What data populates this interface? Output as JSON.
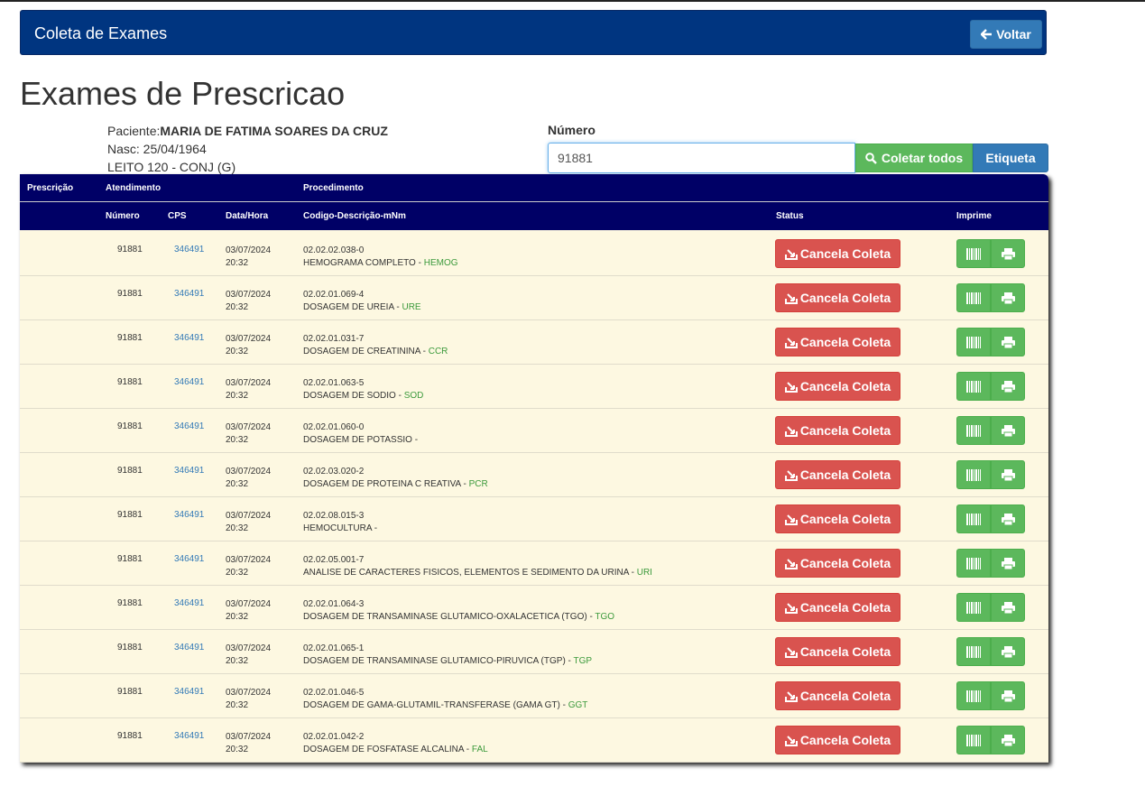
{
  "navbar": {
    "title": "Coleta de Exames",
    "voltar_label": "Voltar"
  },
  "page_title": "Exames de Prescricao",
  "patient": {
    "label": "Paciente:",
    "name": "MARIA DE FATIMA SOARES DA CRUZ",
    "nasc": "Nasc: 25/04/1964",
    "leito": "LEITO 120 - CONJ (G)"
  },
  "numero": {
    "label": "Número",
    "value": "91881"
  },
  "buttons": {
    "coletar_todos": "Coletar todos",
    "etiqueta": "Etiqueta",
    "cancela": "Cancela Coleta"
  },
  "table": {
    "header1": {
      "prescricao": "Prescrição",
      "atendimento": "Atendimento",
      "procedimento": "Procedimento"
    },
    "header2": {
      "numero": "Número",
      "cps": "CPS",
      "datahora": "Data/Hora",
      "codigo": "Codigo-Descrição-mNm",
      "status": "Status",
      "imprime": "Imprime"
    },
    "rows": [
      {
        "numero": "91881",
        "cps": "346491",
        "data": "03/07/2024",
        "hora": "20:32",
        "codigo": "02.02.02.038-0",
        "descricao": "HEMOGRAMA COMPLETO - ",
        "sigla": "HEMOG"
      },
      {
        "numero": "91881",
        "cps": "346491",
        "data": "03/07/2024",
        "hora": "20:32",
        "codigo": "02.02.01.069-4",
        "descricao": "DOSAGEM DE UREIA - ",
        "sigla": "URE"
      },
      {
        "numero": "91881",
        "cps": "346491",
        "data": "03/07/2024",
        "hora": "20:32",
        "codigo": "02.02.01.031-7",
        "descricao": "DOSAGEM DE CREATININA - ",
        "sigla": "CCR"
      },
      {
        "numero": "91881",
        "cps": "346491",
        "data": "03/07/2024",
        "hora": "20:32",
        "codigo": "02.02.01.063-5",
        "descricao": "DOSAGEM DE SODIO - ",
        "sigla": "SOD"
      },
      {
        "numero": "91881",
        "cps": "346491",
        "data": "03/07/2024",
        "hora": "20:32",
        "codigo": "02.02.01.060-0",
        "descricao": "DOSAGEM DE POTASSIO - ",
        "sigla": ""
      },
      {
        "numero": "91881",
        "cps": "346491",
        "data": "03/07/2024",
        "hora": "20:32",
        "codigo": "02.02.03.020-2",
        "descricao": "DOSAGEM DE PROTEINA C REATIVA - ",
        "sigla": "PCR"
      },
      {
        "numero": "91881",
        "cps": "346491",
        "data": "03/07/2024",
        "hora": "20:32",
        "codigo": "02.02.08.015-3",
        "descricao": "HEMOCULTURA - ",
        "sigla": ""
      },
      {
        "numero": "91881",
        "cps": "346491",
        "data": "03/07/2024",
        "hora": "20:32",
        "codigo": "02.02.05.001-7",
        "descricao": "ANALISE DE CARACTERES FISICOS, ELEMENTOS E SEDIMENTO DA URINA - ",
        "sigla": "URI"
      },
      {
        "numero": "91881",
        "cps": "346491",
        "data": "03/07/2024",
        "hora": "20:32",
        "codigo": "02.02.01.064-3",
        "descricao": "DOSAGEM DE TRANSAMINASE GLUTAMICO-OXALACETICA (TGO) - ",
        "sigla": "TGO"
      },
      {
        "numero": "91881",
        "cps": "346491",
        "data": "03/07/2024",
        "hora": "20:32",
        "codigo": "02.02.01.065-1",
        "descricao": "DOSAGEM DE TRANSAMINASE GLUTAMICO-PIRUVICA (TGP) - ",
        "sigla": "TGP"
      },
      {
        "numero": "91881",
        "cps": "346491",
        "data": "03/07/2024",
        "hora": "20:32",
        "codigo": "02.02.01.046-5",
        "descricao": "DOSAGEM DE GAMA-GLUTAMIL-TRANSFERASE (GAMA GT) - ",
        "sigla": "GGT"
      },
      {
        "numero": "91881",
        "cps": "346491",
        "data": "03/07/2024",
        "hora": "20:32",
        "codigo": "02.02.01.042-2",
        "descricao": "DOSAGEM DE FOSFATASE ALCALINA - ",
        "sigla": "FAL"
      }
    ]
  },
  "colors": {
    "navbar": "#003580",
    "table_header": "#000066",
    "row_bg": "#fdf8e1",
    "danger": "#d9534f",
    "success": "#5cb85c",
    "primary": "#337ab7",
    "sigla": "#3c9a3c"
  },
  "icons": {
    "voltar": "arrow-left-icon",
    "coletar": "search-icon",
    "cancela": "cancel-tray-icon",
    "etiqueta": "barcode-icon",
    "imprimir": "printer-icon"
  }
}
